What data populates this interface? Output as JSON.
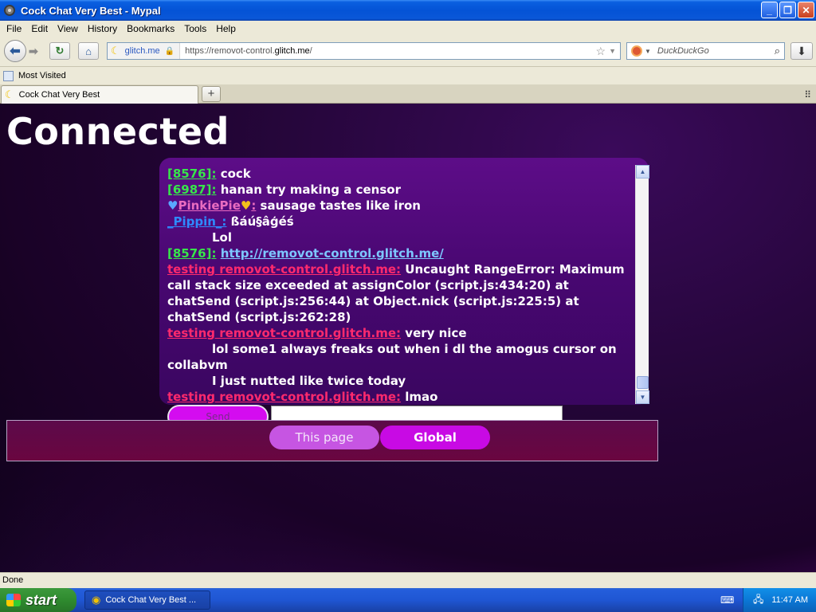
{
  "window": {
    "title": "Cock Chat Very Best - Mypal"
  },
  "menu": [
    "File",
    "Edit",
    "View",
    "History",
    "Bookmarks",
    "Tools",
    "Help"
  ],
  "navbar": {
    "site_identity": "glitch.me",
    "url_prefix": "https://removot-control.",
    "url_domain": "glitch.me",
    "url_suffix": "/",
    "search_placeholder": "DuckDuckGo"
  },
  "bookmarks": {
    "most_visited": "Most Visited"
  },
  "tabs": {
    "active_tab": "Cock Chat Very Best"
  },
  "page": {
    "heading": "Connected",
    "messages": [
      {
        "user": "[8576]:",
        "user_style": "green",
        "text": " cock"
      },
      {
        "user": "[6987]:",
        "user_style": "green",
        "text": " hanan try making a censor"
      },
      {
        "user": "PinkiePie",
        "user_style": "pink",
        "hearts": true,
        "text": " sausage tastes like iron"
      },
      {
        "user": "_Pippin_:",
        "user_style": "blue",
        "text": " ßáú§âģéś"
      },
      {
        "user": "",
        "user_style": "none",
        "text": "Lol"
      },
      {
        "user": "[8576]:",
        "user_style": "green",
        "link": "http://removot-control.glitch.me/"
      },
      {
        "user": "testing removot-control.glitch.me:",
        "user_style": "red",
        "text": " Uncaught RangeError: Maximum call stack size exceeded     at assignColor (script.js:434:20)     at chatSend (script.js:256:44)     at Object.nick (script.js:225:5)     at chatSend (script.js:262:28)"
      },
      {
        "user": "testing removot-control.glitch.me:",
        "user_style": "red",
        "text": " very nice"
      },
      {
        "user": "",
        "user_style": "none",
        "text": "lol some1 always freaks out when i dl the amogus cursor on collabvm"
      },
      {
        "user": "",
        "user_style": "none",
        "text": "I just nutted like twice today"
      },
      {
        "user": "testing removot-control.glitch.me:",
        "user_style": "red",
        "text": " lmao"
      }
    ],
    "send_label": "Send",
    "message_input_value": "",
    "this_page_label": "This page",
    "global_label": "Global"
  },
  "status": {
    "text": "Done"
  },
  "taskbar": {
    "start_label": "start",
    "task_label": "Cock Chat Very Best ...",
    "clock": "11:47 AM"
  },
  "colors": {
    "user_green": "#37e64a",
    "user_pink": "#e96cc0",
    "user_blue": "#2e8bff",
    "user_red": "#ff2a6d",
    "send_button": "#d40cf0",
    "global_button": "#c80ae4"
  }
}
